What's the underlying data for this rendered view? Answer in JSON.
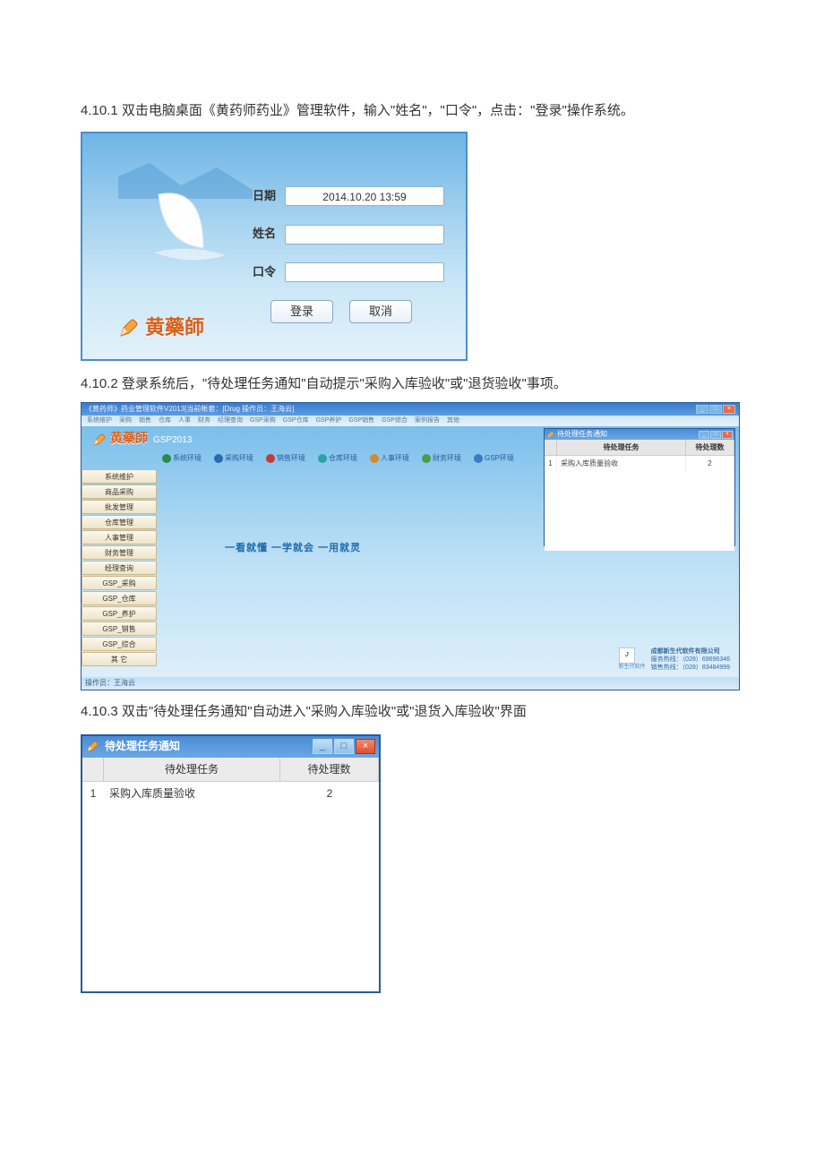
{
  "doc": {
    "p1": "4.10.1 双击电脑桌面《黄药师药业》管理软件，输入\"姓名\"，\"口令\"，点击：\"登录\"操作系统。",
    "p2": "4.10.2 登录系统后，\"待处理任务通知\"自动提示\"采购入库验收\"或\"退货验收\"事项。",
    "p3": "4.10.3 双击\"待处理任务通知\"自动进入\"采购入库验收\"或\"退货入库验收\"界面"
  },
  "login": {
    "brand": "黄藥師",
    "fields": {
      "date_label": "日期",
      "date_value": "2014.10.20  13:59",
      "name_label": "姓名",
      "name_value": "",
      "pass_label": "口令",
      "pass_value": ""
    },
    "buttons": {
      "login": "登录",
      "cancel": "取消"
    }
  },
  "app": {
    "title": "《黄药师》药业管理软件V2013[当前帐套：[Drug  操作员：王海云]",
    "menu": [
      "系统维护",
      "采购",
      "销售",
      "仓库",
      "人事",
      "财务",
      "经理查询",
      "GSP采购",
      "GSP仓库",
      "GSP养护",
      "GSP销售",
      "GSP综合",
      "案例报告",
      "其他"
    ],
    "brand": "黄藥師",
    "brand_suffix": "GSP2013",
    "toolbar": [
      "系统环境",
      "采购环境",
      "销售环境",
      "仓库环境",
      "人事环境",
      "财务环境",
      "GSP环境"
    ],
    "sidebar": [
      "系统维护",
      "商品采购",
      "批发管理",
      "仓库管理",
      "人事管理",
      "财务管理",
      "经理查询",
      "GSP_采购",
      "GSP_仓库",
      "GSP_养护",
      "GSP_销售",
      "GSP_综合",
      "其 它"
    ],
    "slogan": "一看就懂 一学就会 一用就灵",
    "footer": "操作员：王海云",
    "company": {
      "name": "成都新生代软件有限公司",
      "line2": "服务热线：（028）69696346",
      "line3": "销售热线：（028）83484999",
      "logo_label": "新生代软件"
    }
  },
  "notice": {
    "title": "待处理任务通知",
    "head_task": "待处理任务",
    "head_count": "待处理数",
    "rows": [
      {
        "idx": "1",
        "task": "采购入库质量验收",
        "count": "2"
      }
    ]
  }
}
